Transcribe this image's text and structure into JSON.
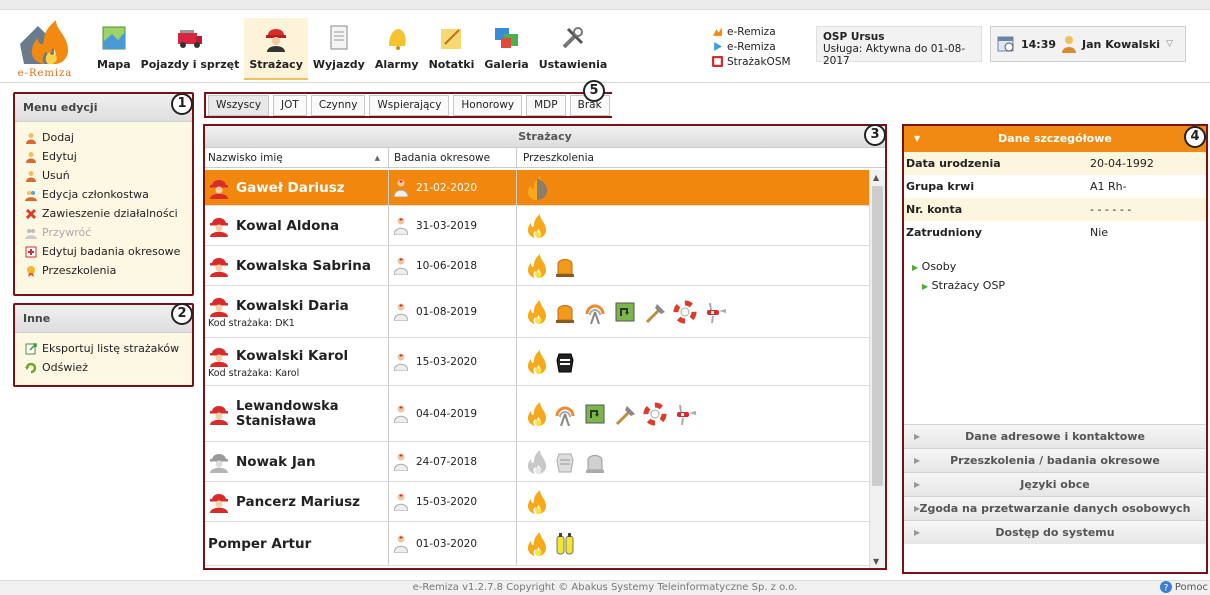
{
  "app": {
    "logo_text": "e-Remiza"
  },
  "nav": [
    {
      "label": "Mapa",
      "icon": "map-icon"
    },
    {
      "label": "Pojazdy i sprzęt",
      "icon": "fire-truck-icon"
    },
    {
      "label": "Strażacy",
      "icon": "firefighter-icon",
      "active": true
    },
    {
      "label": "Wyjazdy",
      "icon": "document-icon"
    },
    {
      "label": "Alarmy",
      "icon": "bell-icon"
    },
    {
      "label": "Notatki",
      "icon": "note-icon"
    },
    {
      "label": "Galeria",
      "icon": "gallery-icon"
    },
    {
      "label": "Ustawienia",
      "icon": "tools-icon"
    }
  ],
  "system_links": [
    "e-Remiza",
    "e-Remiza",
    "StrażakOSM"
  ],
  "unit": {
    "name": "OSP Ursus",
    "service": "Usługa: Aktywna do 01-08-2017"
  },
  "user": {
    "time": "14:39",
    "name": "Jan Kowalski"
  },
  "edit_menu": {
    "title": "Menu edycji",
    "items": [
      {
        "label": "Dodaj",
        "enabled": true
      },
      {
        "label": "Edytuj",
        "enabled": true
      },
      {
        "label": "Usuń",
        "enabled": true
      },
      {
        "label": "Edycja członkostwa",
        "enabled": true
      },
      {
        "label": "Zawieszenie działalności",
        "enabled": true
      },
      {
        "label": "Przywróć",
        "enabled": false
      },
      {
        "label": "Edytuj badania okresowe",
        "enabled": true
      },
      {
        "label": "Przeszkolenia",
        "enabled": true
      }
    ]
  },
  "other_menu": {
    "title": "Inne",
    "items": [
      {
        "label": "Eksportuj listę strażaków"
      },
      {
        "label": "Odśwież"
      }
    ]
  },
  "tabs": [
    "Wszyscy",
    "JOT",
    "Czynny",
    "Wspierający",
    "Honorowy",
    "MDP",
    "Brak"
  ],
  "grid": {
    "title": "Strażacy",
    "columns": [
      "Nazwisko imię",
      "Badania okresowe",
      "Przeszkolenia"
    ],
    "rows": [
      {
        "name": "Gaweł Dariusz",
        "code": "",
        "date": "21-02-2020",
        "trainings": [
          "fire-half"
        ],
        "selected": true,
        "avatar": "red"
      },
      {
        "name": "Kowal Aldona",
        "code": "",
        "date": "31-03-2019",
        "trainings": [
          "fire"
        ],
        "avatar": "red"
      },
      {
        "name": "Kowalska Sabrina",
        "code": "",
        "date": "10-06-2018",
        "trainings": [
          "fire",
          "siren"
        ],
        "avatar": "red"
      },
      {
        "name": "Kowalski Daria",
        "code": "Kod strażaka: DK1",
        "date": "01-08-2019",
        "trainings": [
          "fire",
          "siren",
          "signal",
          "rescue",
          "axe",
          "lifebuoy",
          "knife"
        ],
        "avatar": "red"
      },
      {
        "name": "Kowalski Karol",
        "code": "Kod strażaka: Karol",
        "date": "15-03-2020",
        "trainings": [
          "fire",
          "mask"
        ],
        "avatar": "red"
      },
      {
        "name": "Lewandowska Stanisława",
        "code": "",
        "date": "04-04-2019",
        "trainings": [
          "fire",
          "signal",
          "rescue",
          "axe",
          "lifebuoy",
          "knife"
        ],
        "avatar": "red"
      },
      {
        "name": "Nowak Jan",
        "code": "",
        "date": "24-07-2018",
        "trainings": [
          "fire-grey",
          "mask-grey",
          "siren-grey"
        ],
        "avatar": "grey"
      },
      {
        "name": "Pancerz Mariusz",
        "code": "",
        "date": "15-03-2020",
        "trainings": [
          "fire"
        ],
        "avatar": "red"
      },
      {
        "name": "Pomper Artur",
        "code": "",
        "date": "01-03-2020",
        "trainings": [
          "fire",
          "tanks"
        ],
        "avatar": "none"
      }
    ]
  },
  "details": {
    "title": "Dane szczegółowe",
    "fields": [
      {
        "key": "Data urodzenia",
        "value": "20-04-1992"
      },
      {
        "key": "Grupa krwi",
        "value": "A1 Rh-"
      },
      {
        "key": "Nr. konta",
        "value": "- - - - - -"
      },
      {
        "key": "Zatrudniony",
        "value": "Nie"
      }
    ],
    "tree": [
      "Osoby",
      "Strażacy OSP"
    ],
    "sections": [
      "Dane adresowe i kontaktowe",
      "Przeszkolenia / badania okresowe",
      "Języki obce",
      "Zgoda na przetwarzanie danych osobowych",
      "Dostęp do systemu"
    ]
  },
  "annotations": [
    "1",
    "2",
    "3",
    "4",
    "5"
  ],
  "footer": "e-Remiza v1.2.7.8 Copyright © Abakus Systemy Teleinformatyczne Sp. z o.o.",
  "help": "Pomoc",
  "colors": {
    "accent": "#f2870e",
    "frame": "#7a1215",
    "menu_bg": "#fdf8e4"
  }
}
